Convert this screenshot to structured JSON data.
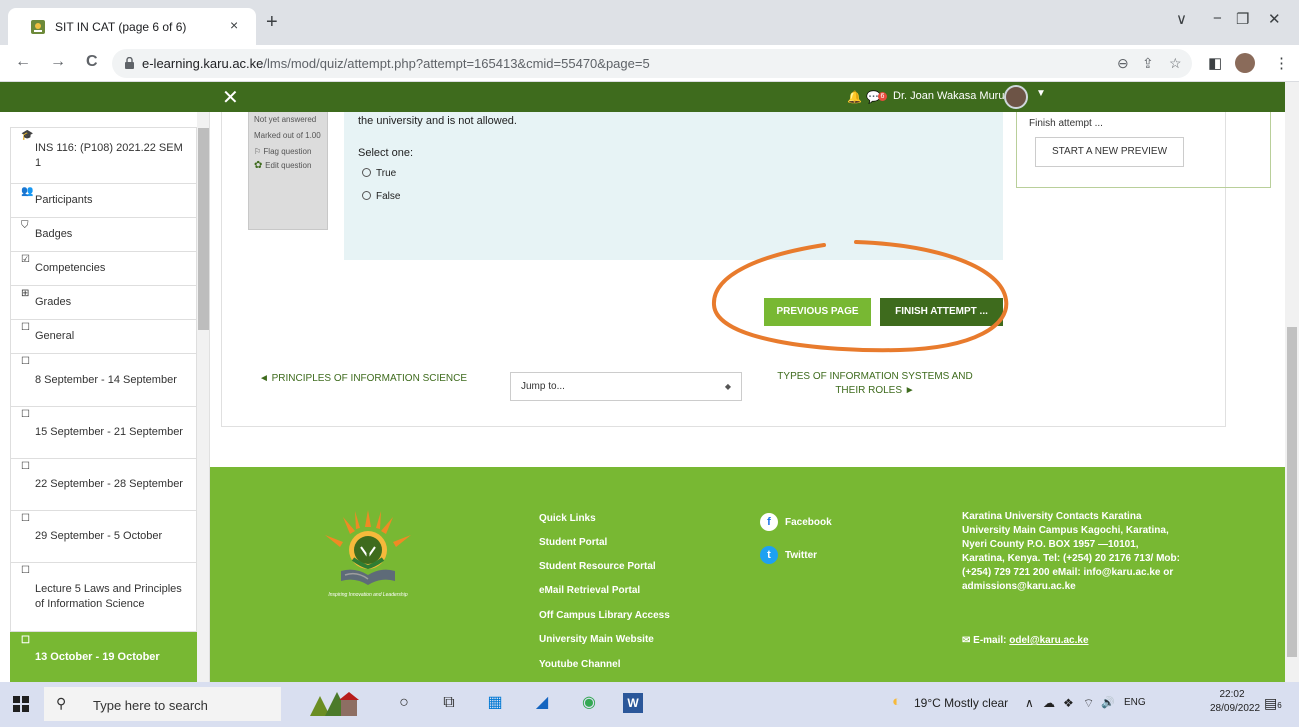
{
  "browser": {
    "tab_title": "SIT IN CAT (page 6 of 6)",
    "tab_close": "×",
    "new_tab": "+",
    "url_host": "e-learning.karu.ac.ke",
    "url_path": "/lms/mod/quiz/attempt.php?attempt=165413&cmid=55470&page=5",
    "back_icon": "←",
    "forward_icon": "→",
    "reload_icon": "C",
    "zoom_icon": "⊖",
    "share_icon": "⇪",
    "star_icon": "☆",
    "sidepanel_icon": "◧",
    "menu_icon": "⋮",
    "minimize_icon": "−",
    "restore_icon": "❐",
    "close_icon": "✕",
    "tabsearch_icon": "∨"
  },
  "topbar": {
    "close_label": "✕",
    "bell_icon": "🔔",
    "msg_icon": "💬",
    "msg_badge": "6",
    "username": "Dr. Joan Wakasa Murumba",
    "caret": "▼"
  },
  "sidebar": {
    "items": [
      {
        "icon": "🎓",
        "label": "INS 116: (P108) 2021.22 SEM 1"
      },
      {
        "icon": "👥",
        "label": "Participants"
      },
      {
        "icon": "⛉",
        "label": "Badges"
      },
      {
        "icon": "☑",
        "label": "Competencies"
      },
      {
        "icon": "⊞",
        "label": "Grades"
      },
      {
        "icon": "☐",
        "label": "General"
      },
      {
        "icon": "☐",
        "label": "8 September - 14 September"
      },
      {
        "icon": "☐",
        "label": "15 September - 21 September"
      },
      {
        "icon": "☐",
        "label": "22 September - 28 September"
      },
      {
        "icon": "☐",
        "label": "29 September - 5 October"
      },
      {
        "icon": "☐",
        "label": "Lecture 5 Laws and Principles of Information Science"
      },
      {
        "icon": "☐",
        "label": "13 October - 19 October"
      }
    ]
  },
  "question": {
    "status": "Not yet answered",
    "marked": "Marked out of 1.00",
    "flag": "Flag question",
    "edit": "Edit question",
    "text": "the university and is not allowed.",
    "select_one": "Select one:",
    "options": [
      "True",
      "False"
    ]
  },
  "quiz_nav": {
    "finish_attempt_link": "Finish attempt ...",
    "preview_button": "START A NEW PREVIEW"
  },
  "buttons": {
    "previous_page": "PREVIOUS PAGE",
    "finish_attempt": "FINISH ATTEMPT ..."
  },
  "activity_nav": {
    "prev": "◄ PRINCIPLES OF INFORMATION SCIENCE",
    "jump": "Jump to...",
    "jump_caret": "◆",
    "next": "TYPES OF INFORMATION SYSTEMS AND THEIR ROLES ►"
  },
  "footer": {
    "logo_tagline": "Inspiring Innovation and Leadership",
    "quick_links_title": "Quick Links",
    "quick_links": [
      "Student Portal",
      "Student Resource Portal",
      "eMail Retrieval Portal",
      "Off Campus Library Access",
      "University Main Website",
      "Youtube Channel"
    ],
    "facebook": "Facebook",
    "facebook_glyph": "f",
    "twitter": "Twitter",
    "twitter_glyph": "t",
    "contacts": "Karatina University Contacts Karatina University Main Campus Kagochi, Karatina, Nyeri County P.O. BOX 1957 —10101, Karatina, Kenya. Tel: (+254) 20 2176 713/ Mob: (+254) 729 721 200 eMail: info@karu.ac.ke or admissions@karu.ac.ke",
    "email_prefix": "✉ E-mail: ",
    "email": "odel@karu.ac.ke"
  },
  "taskbar": {
    "search_placeholder": "Type here to search",
    "search_glyph": "⚲",
    "weather": "19°C  Mostly clear",
    "lang": "ENG",
    "time": "22:02",
    "date": "28/09/2022",
    "notify_count": "6",
    "cortana_glyph": "○",
    "taskview_glyph": "⧉",
    "store_glyph": "▦",
    "chart_glyph": "◢",
    "chrome_glyph": "◉",
    "word_glyph": "W",
    "tray_up": "∧",
    "tray_cloud": "☁",
    "tray_app": "❖",
    "tray_wifi": "⌔",
    "tray_volume": "🔊"
  },
  "colors": {
    "brand_dark": "#3e6b1d",
    "brand_light": "#78b833",
    "annotation": "#e87b2d"
  }
}
